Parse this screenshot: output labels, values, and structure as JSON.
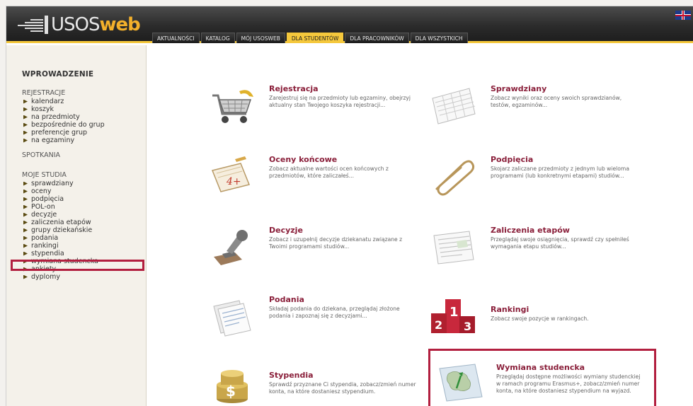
{
  "app": {
    "logo_uso": "USOS",
    "logo_web": "web"
  },
  "nav": {
    "tabs": [
      {
        "label": "AKTUALNOŚCI"
      },
      {
        "label": "KATALOG"
      },
      {
        "label": "MÓJ USOSWEB"
      },
      {
        "label": "DLA STUDENTÓW",
        "active": true
      },
      {
        "label": "DLA PRACOWNIKÓW"
      },
      {
        "label": "DLA WSZYSTKICH"
      }
    ]
  },
  "sidebar": {
    "heading": "WPROWADZENIE",
    "sections": {
      "rejestracje": {
        "title": "REJESTRACJE",
        "items": [
          "kalendarz",
          "koszyk",
          "na przedmioty",
          "bezpośrednie do grup",
          "preferencje grup",
          "na egzaminy"
        ]
      },
      "spotkania": {
        "title": "SPOTKANIA"
      },
      "moje_studia": {
        "title": "MOJE STUDIA",
        "items": [
          "sprawdziany",
          "oceny",
          "podpięcia",
          "POL-on",
          "decyzje",
          "zaliczenia etapów",
          "grupy dziekańskie",
          "podania",
          "rankingi",
          "stypendia",
          "wymiana studencka",
          "ankiety",
          "dyplomy"
        ]
      }
    }
  },
  "main": {
    "items": [
      {
        "title": "Rejestracja",
        "desc": "Zarejestruj się na przedmioty lub egzaminy, obejrzyj aktualny stan Twojego koszyka rejestracji...",
        "icon": "shopping-cart-icon"
      },
      {
        "title": "Sprawdziany",
        "desc": "Zobacz wyniki oraz oceny swoich sprawdzianów, testów, egzaminów...",
        "icon": "spreadsheet-icon"
      },
      {
        "title": "Oceny końcowe",
        "desc": "Zobacz aktualne wartości ocen końcowych z przedmiotów, które zaliczałeś...",
        "icon": "grade-card-icon"
      },
      {
        "title": "Podpięcia",
        "desc": "Skojarz zaliczane przedmioty z jednym lub wieloma programami (lub konkretnymi etapami) studiów...",
        "icon": "paperclip-icon"
      },
      {
        "title": "Decyzje",
        "desc": "Zobacz i uzupełnij decyzje dziekanatu związane z Twoimi programami studiów...",
        "icon": "stamp-icon"
      },
      {
        "title": "Zaliczenia etapów",
        "desc": "Przeglądaj swoje osiągnięcia, sprawdź czy spełniłeś wymagania etapu studiów...",
        "icon": "document-icon"
      },
      {
        "title": "Podania",
        "desc": "Składaj podania do dziekana, przeglądaj złożone podania i zapoznaj się z decyzjami...",
        "icon": "papers-icon"
      },
      {
        "title": "Rankingi",
        "desc": "Zobacz swoje pozycje w rankingach.",
        "icon": "podium-icon"
      },
      {
        "title": "Stypendia",
        "desc": "Sprawdź przyznane Ci stypendia, zobacz/zmień numer konta, na które dostaniesz stypendium.",
        "icon": "coins-icon"
      },
      {
        "title": "Wymiana studencka",
        "desc": "Przeglądaj dostępne możliwości wymiany studenckiej w ramach programu Erasmus+, zobacz/zmień numer konta, na które dostaniesz stypendium na wyjazd.",
        "icon": "europe-map-icon"
      }
    ]
  },
  "colors": {
    "accent_yellow": "#f5c83c",
    "title_maroon": "#8a1f3a",
    "highlight_red": "#b21f3f"
  }
}
